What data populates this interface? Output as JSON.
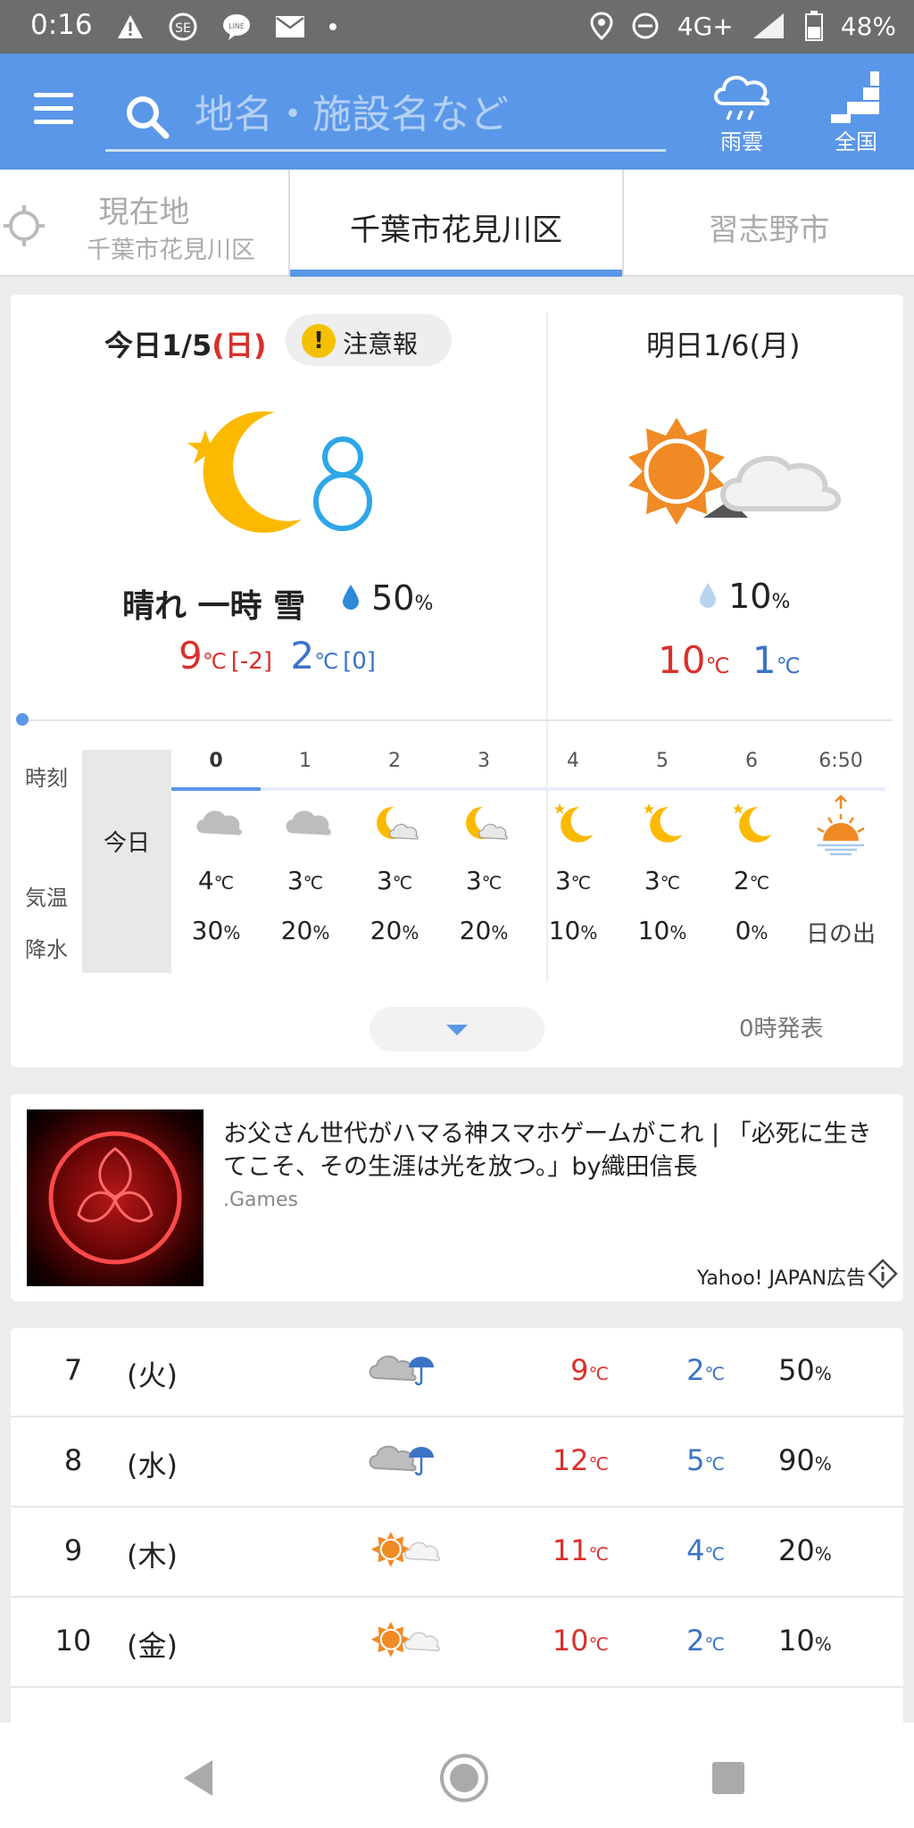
{
  "status_bar": {
    "time": "0:16",
    "network": "4G+",
    "battery": "48%"
  },
  "header": {
    "search_placeholder": "地名・施設名など",
    "rain_cloud_label": "雨雲",
    "nationwide_label": "全国"
  },
  "tabs": {
    "current_location_label": "現在地",
    "current_location_sub": "千葉市花見川区",
    "selected": "千葉市花見川区",
    "next": "習志野市"
  },
  "today": {
    "date_prefix": "今日1/5",
    "weekday": "(日)",
    "alert": "注意報",
    "condition": "晴れ 一時 雪",
    "precip": "50",
    "precip_unit": "%",
    "high": "9",
    "high_diff": "[-2]",
    "low": "2",
    "low_diff": "[0]",
    "unit": "℃"
  },
  "tomorrow": {
    "date": "明日1/6(月)",
    "precip": "10",
    "precip_unit": "%",
    "high": "10",
    "low": "1",
    "unit": "℃"
  },
  "hourly": {
    "row_labels": {
      "time": "時刻",
      "temp": "気温",
      "precip": "降水"
    },
    "day_label": "今日",
    "hours": [
      {
        "hour": "0",
        "icon": "cloud-icon",
        "temp": "4",
        "precip": "30"
      },
      {
        "hour": "1",
        "icon": "cloud-icon",
        "temp": "3",
        "precip": "20"
      },
      {
        "hour": "2",
        "icon": "moon-cloud-icon",
        "temp": "3",
        "precip": "20"
      },
      {
        "hour": "3",
        "icon": "moon-cloud-icon",
        "temp": "3",
        "precip": "20"
      },
      {
        "hour": "4",
        "icon": "moon-icon",
        "temp": "3",
        "precip": "10"
      },
      {
        "hour": "5",
        "icon": "moon-icon",
        "temp": "3",
        "precip": "10"
      },
      {
        "hour": "6",
        "icon": "moon-icon",
        "temp": "2",
        "precip": "0"
      }
    ],
    "sunrise": {
      "time": "6:50",
      "label": "日の出",
      "icon": "sunrise-icon"
    },
    "temp_unit": "℃",
    "precip_unit": "%",
    "issued": "0時発表"
  },
  "ad": {
    "title": "お父さん世代がハマる神スマホゲームがこれ | 「必死に生きてこそ、その生涯は光を放つ。」by織田信長",
    "source": ".Games",
    "label": "Yahoo! JAPAN広告"
  },
  "weekly": [
    {
      "day": "7",
      "weekday": "(火)",
      "icon": "cloud-umbrella-icon",
      "high": "9",
      "low": "2",
      "precip": "50"
    },
    {
      "day": "8",
      "weekday": "(水)",
      "icon": "cloud-umbrella-icon",
      "high": "12",
      "low": "5",
      "precip": "90"
    },
    {
      "day": "9",
      "weekday": "(木)",
      "icon": "sun-cloud-icon",
      "high": "11",
      "low": "4",
      "precip": "20"
    },
    {
      "day": "10",
      "weekday": "(金)",
      "icon": "sun-cloud-icon",
      "high": "10",
      "low": "2",
      "precip": "10"
    }
  ],
  "colors": {
    "accent": "#5a97e8",
    "high": "#d9302b",
    "low": "#3b73c7",
    "sun": "#f08a24",
    "moon": "#fbb900"
  }
}
